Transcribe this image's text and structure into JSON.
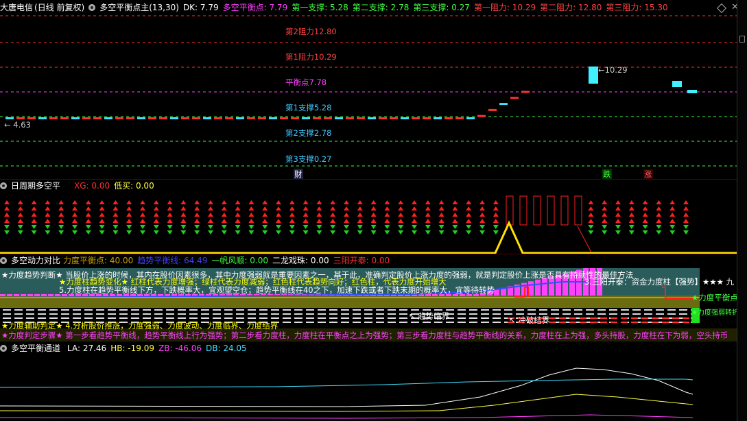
{
  "main": {
    "stock": "大唐电信",
    "mode": "(日线 前复权)",
    "indicator": "多空平衡点主",
    "params": "(13,30)",
    "dk": "DK: 7.79",
    "balance": "多空平衡点: 7.79",
    "s1": "第一支撑: 5.28",
    "s2": "第二支撑: 2.78",
    "s3": "第三支撑: 0.27",
    "r1": "第一阻力: 10.29",
    "r2": "第二阻力: 12.80",
    "r3": "第三阻力: 15.30",
    "lvl_r2": "第2阻力12.80",
    "lvl_r1": "第1阻力10.29",
    "lvl_bal": "平衡点7.78",
    "lvl_s1": "第1支撑5.28",
    "lvl_s2": "第2支撑2.78",
    "lvl_s3": "第3支撑0.27",
    "low_label": "4.63",
    "high_label": "10.29",
    "mark_cai": "财",
    "mark_die": "跌",
    "mark_zhang": "涨"
  },
  "p2": {
    "title": "日周期多空平",
    "xg": "XG: 0.00",
    "low_buy": "低买: 0.00"
  },
  "p3": {
    "title": "多空动力对比",
    "v1": "力度平衡点: 40.00",
    "v2": "趋势平衡线: 64.49",
    "v3": "一帆风顺: 0.00",
    "v4": "二龙戏珠: 0.00",
    "v5": "三阳开泰: 0.00",
    "line1": "★力度趋势判断★ 当股价上涨的时候，其内在股价因素很多，其中力度强弱就是重要因素之一，基于此，准确判定股价上涨力度的强弱，就是判定股价上涨是否具有持续性的最佳方法",
    "line2": "★力度柱趋势变化★ 红柱代表力度增强；绿柱代表力度减弱；红色柱代表趋势向好；红色柱，代表力度开始增大",
    "line3": "5.力度柱在趋势平衡线下方，下跌概率大，宜观望空仓；趋势平衡线在40之下，加速下跌或者下跌末期的概率大，宜等待转势",
    "right_note": "3.三阳开泰：资金力度柱【强势】★★★ 九",
    "right_label": "★力度平衡点",
    "right_green": "★力度强弱转折",
    "arrow1": "↖ 趋势临界",
    "arrow2": "↖ 冲破结界",
    "line4": "★力度辅助判定★ 4.分析股价推涨，力度强弱、力度波动、力度临界、力度结界",
    "line5": "★力度判定步骤★ 第一步看趋势平衡线，趋势平衡线上行为强势；第二步看力度柱，力度柱在平衡点之上为强势；第三步看力度柱与趋势平衡线的关系，力度柱在上为强，多头持股，力度柱在下为弱，空头持币"
  },
  "p4": {
    "title": "多空平衡通道",
    "la": "LA: 27.46",
    "hb": "HB: -19.09",
    "zb": "ZB: -46.06",
    "db": "DB: 24.05"
  }
}
